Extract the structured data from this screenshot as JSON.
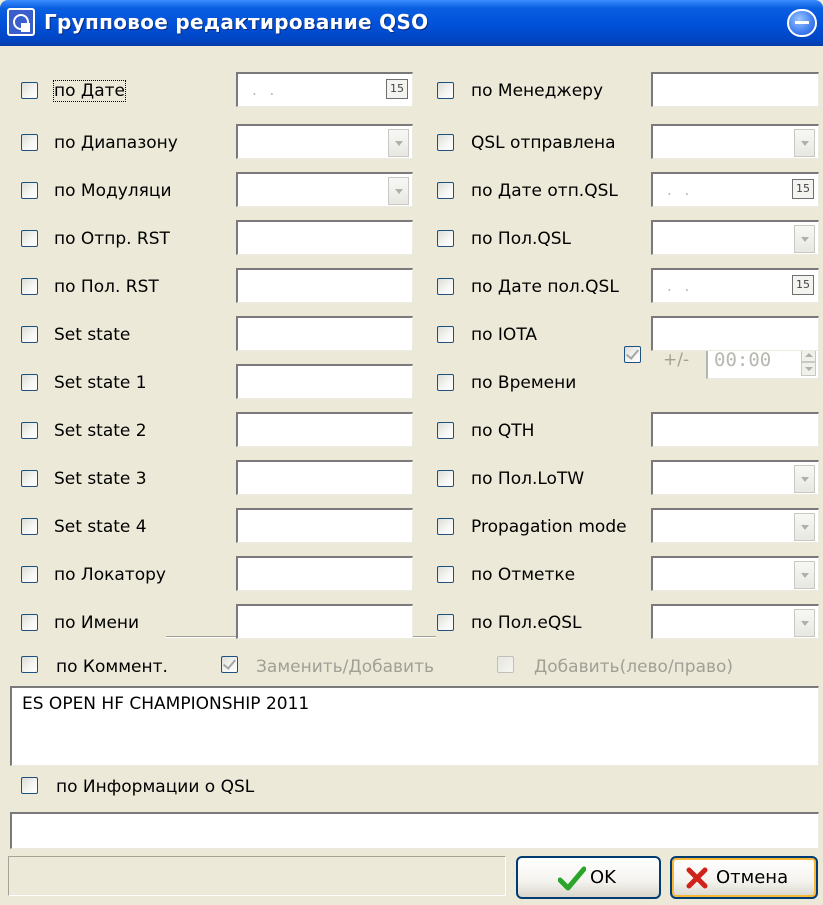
{
  "window": {
    "title": "Групповое редактирование QSO",
    "icon": "qso-app-icon",
    "roll_icon": "window-rollup-icon"
  },
  "left_fields": [
    {
      "label": "по Дате",
      "type": "date",
      "value": ". ."
    },
    {
      "label": "по Диапазону",
      "type": "combo",
      "value": ""
    },
    {
      "label": "по Модуляци",
      "type": "combo",
      "value": ""
    },
    {
      "label": "по Отпр. RST",
      "type": "text",
      "value": ""
    },
    {
      "label": "по Пол. RST",
      "type": "text",
      "value": ""
    },
    {
      "label": "Set state",
      "type": "text",
      "value": ""
    },
    {
      "label": "Set state 1",
      "type": "text",
      "value": ""
    },
    {
      "label": "Set state 2",
      "type": "text",
      "value": ""
    },
    {
      "label": "Set state 3",
      "type": "text",
      "value": ""
    },
    {
      "label": "Set state 4",
      "type": "text",
      "value": ""
    },
    {
      "label": "по Локатору",
      "type": "text",
      "value": ""
    },
    {
      "label": "по Имени",
      "type": "text",
      "value": ""
    }
  ],
  "right_fields": [
    {
      "label": "по Менеджеру",
      "type": "text",
      "value": ""
    },
    {
      "label": "QSL отправлена",
      "type": "combo",
      "value": ""
    },
    {
      "label": "по Дате отп.QSL",
      "type": "date",
      "value": ". ."
    },
    {
      "label": "по Пол.QSL",
      "type": "combo",
      "value": ""
    },
    {
      "label": "по Дате пол.QSL",
      "type": "date",
      "value": ". ."
    },
    {
      "label": "по IOTA",
      "type": "text",
      "value": ""
    },
    {
      "label": "по Времени",
      "type": "time",
      "value": ""
    },
    {
      "label": "по QTH",
      "type": "text",
      "value": ""
    },
    {
      "label": "по Пол.LoTW",
      "type": "combo",
      "value": ""
    },
    {
      "label": "Propagation mode",
      "type": "combo",
      "value": ""
    },
    {
      "label": "по Отметке",
      "type": "combo",
      "value": ""
    },
    {
      "label": "по Пол.eQSL",
      "type": "combo",
      "value": ""
    }
  ],
  "calendar_label": "15",
  "time": {
    "plusminus_label": "+/-",
    "value": "00:00"
  },
  "comment": {
    "label": "по Коммент.",
    "replace_add_label": "Заменить/Добавить",
    "add_side_label": "Добавить(лево/право)",
    "text": "ES OPEN HF CHAMPIONSHIP 2011"
  },
  "qsl_info": {
    "label": "по Информации о QSL",
    "value": ""
  },
  "buttons": {
    "ok_label": "OK",
    "cancel_label": "Отмена"
  },
  "colors": {
    "dialog_bg": "#ECE9D8",
    "titlebar": "#0050D8",
    "ok_check": "#2aa52a",
    "cancel_x": "#d0211b"
  }
}
